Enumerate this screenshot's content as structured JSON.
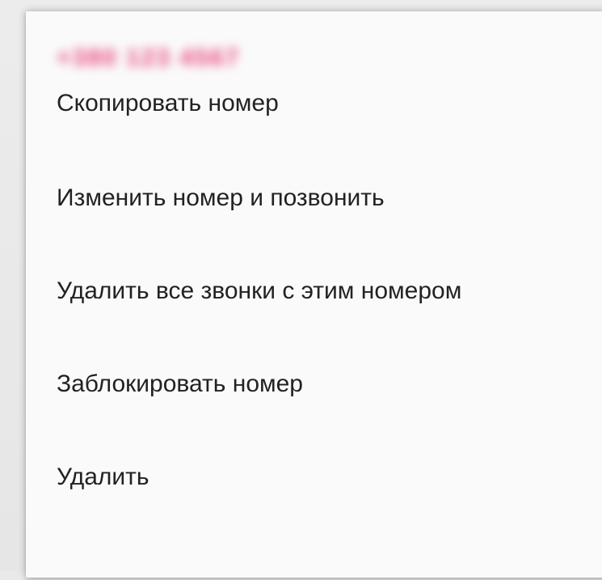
{
  "dialog": {
    "title_phone_number": "+380 123 4567",
    "menu_items": [
      {
        "label": "Скопировать номер"
      },
      {
        "label": "Изменить номер и позвонить"
      },
      {
        "label": "Удалить все звонки с этим номером"
      },
      {
        "label": "Заблокировать номер"
      },
      {
        "label": "Удалить"
      }
    ]
  },
  "colors": {
    "dialog_background": "#fafafa",
    "text": "#222222",
    "redacted_title": "#e8437a"
  }
}
